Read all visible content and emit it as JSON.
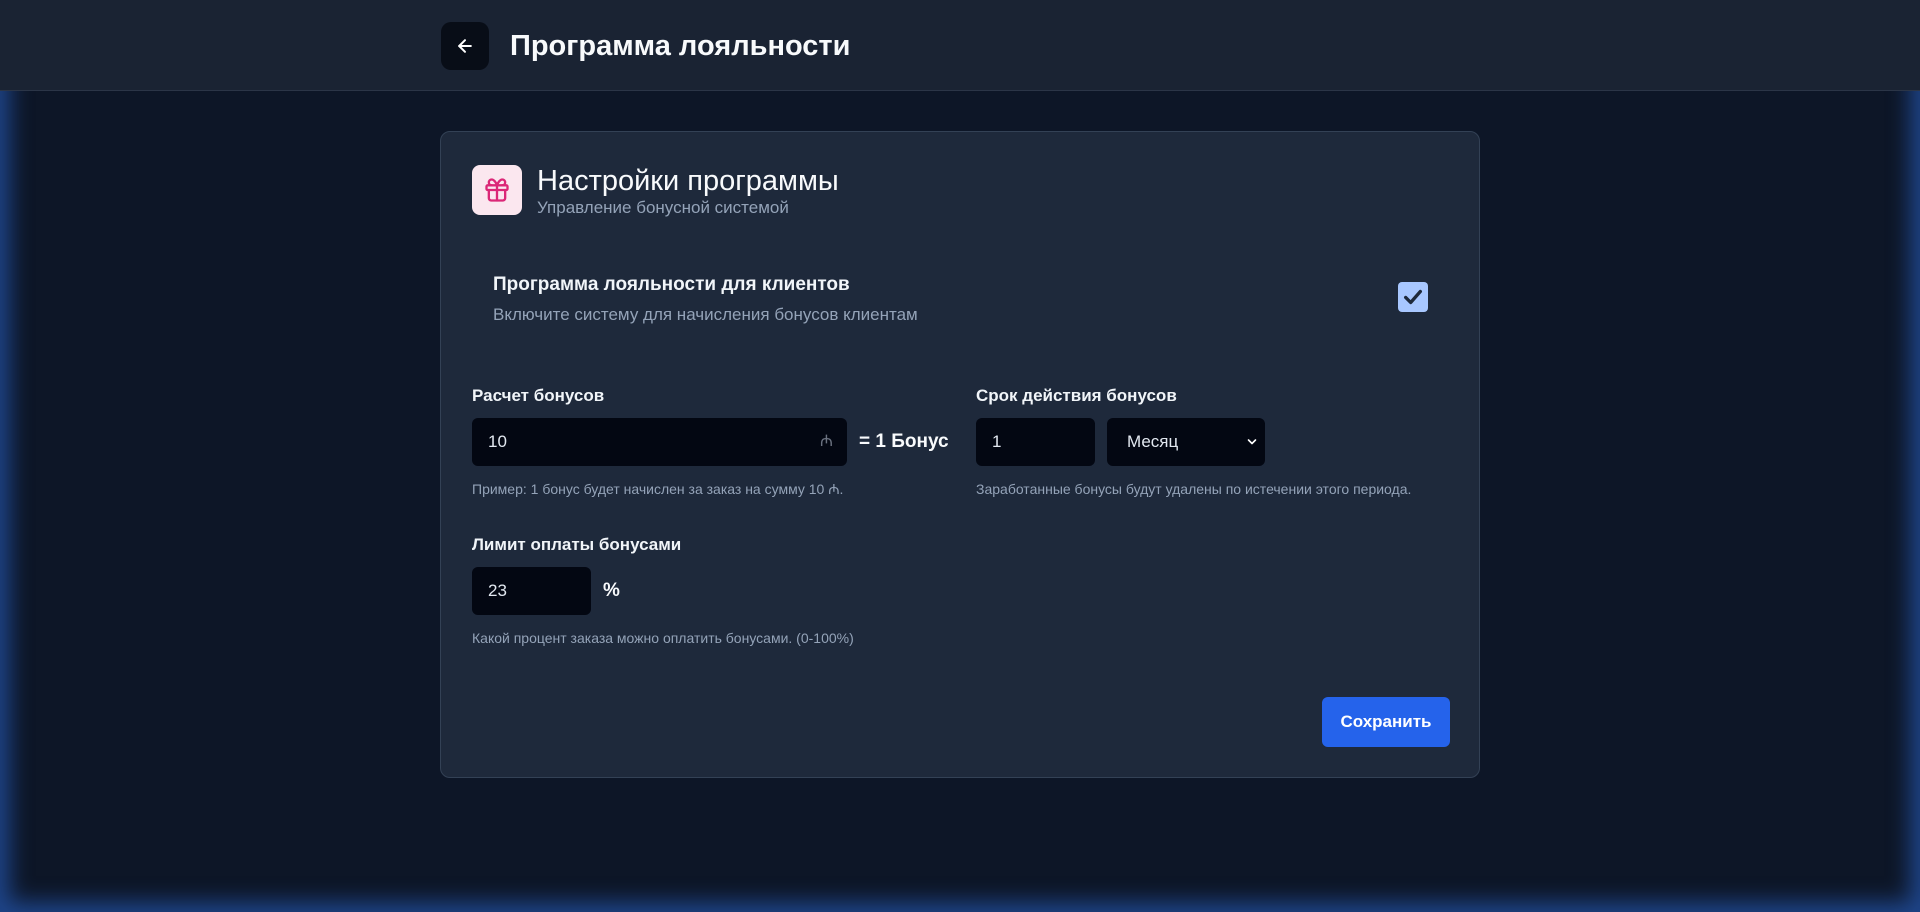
{
  "header": {
    "title": "Программа лояльности",
    "back_icon": "arrow-left-icon"
  },
  "card": {
    "icon": "gift-icon",
    "title": "Настройки программы",
    "subtitle": "Управление бонусной системой",
    "toggle": {
      "title": "Программа лояльности для клиентов",
      "description": "Включите систему для начисления бонусов клиентам",
      "checked": true
    },
    "bonus_calc": {
      "label": "Расчет бонусов",
      "value": "10",
      "currency": "₼",
      "equals_text": "= 1 Бонус",
      "hint": "Пример: 1 бонус будет начислен за заказ на сумму 10 ₼."
    },
    "bonus_expiry": {
      "label": "Срок действия бонусов",
      "value": "1",
      "unit": "Месяц",
      "hint": "Заработанные бонусы будут удалены по истечении этого периода."
    },
    "payment_limit": {
      "label": "Лимит оплаты бонусами",
      "value": "23",
      "unit": "%",
      "hint": "Какой процент заказа можно оплатить бонусами. (0-100%)"
    },
    "save_label": "Сохранить"
  },
  "colors": {
    "background": "#0d1627",
    "topbar": "#1a2333",
    "card": "#1e293b",
    "input": "#030712",
    "accent": "#2563eb",
    "gift_icon": "#db2777",
    "checkbox": "#a8c7ff"
  }
}
